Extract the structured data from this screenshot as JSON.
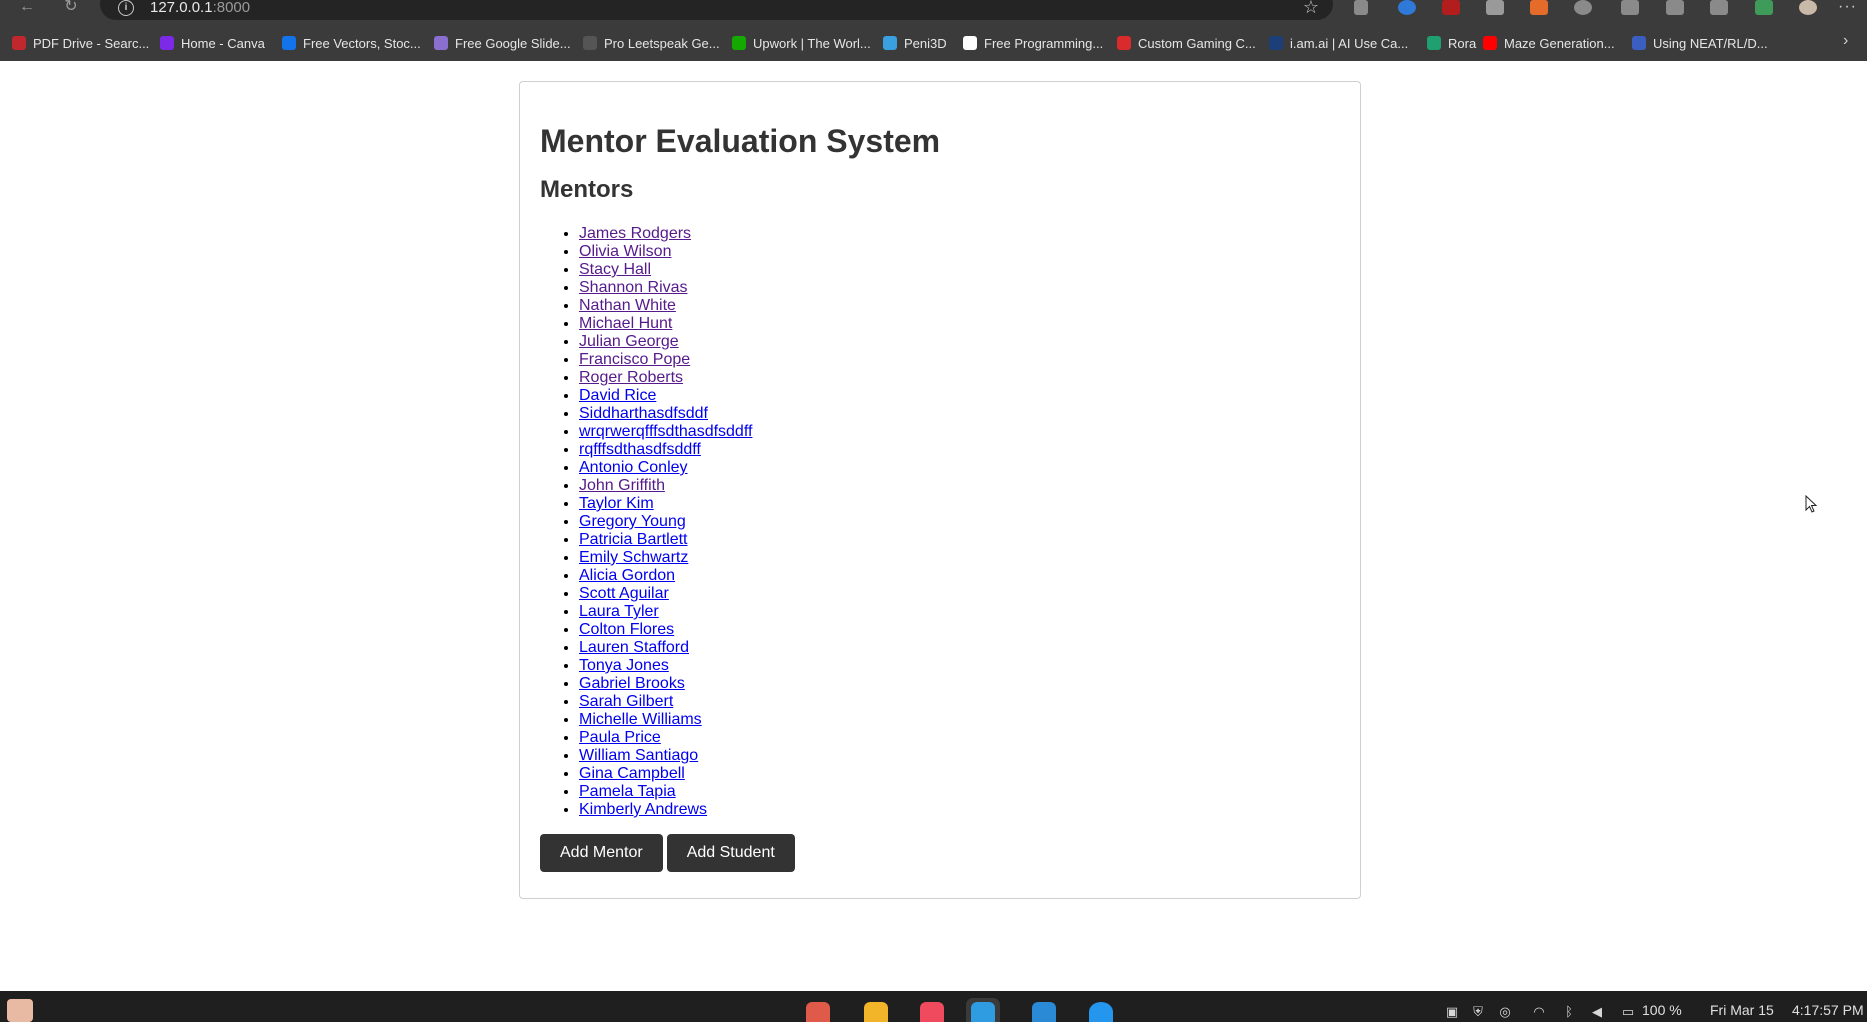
{
  "browser": {
    "url_host": "127.0.0.1",
    "url_port": ":8000",
    "bookmarks": [
      {
        "label": "PDF Drive - Searc...",
        "icon": "pdf-drive-icon",
        "color": "#c0282d"
      },
      {
        "label": "Home - Canva",
        "icon": "canva-icon",
        "color": "#7d2ae8"
      },
      {
        "label": "Free Vectors, Stoc...",
        "icon": "freepik-icon",
        "color": "#1273eb"
      },
      {
        "label": "Free Google Slide...",
        "icon": "slides-icon",
        "color": "#8a6fd1"
      },
      {
        "label": "Pro Leetspeak Ge...",
        "icon": "leetspeak-icon",
        "color": "#555555"
      },
      {
        "label": "Upwork | The Worl...",
        "icon": "upwork-icon",
        "color": "#14a800"
      },
      {
        "label": "Peni3D",
        "icon": "peni3d-icon",
        "color": "#3aa0e0"
      },
      {
        "label": "Free Programming...",
        "icon": "programming-icon",
        "color": "#ffffff"
      },
      {
        "label": "Custom Gaming C...",
        "icon": "gaming-icon",
        "color": "#d92b2b"
      },
      {
        "label": "i.am.ai | AI Use Ca...",
        "icon": "iamai-icon",
        "color": "#1c3f7a"
      },
      {
        "label": "Rora",
        "icon": "rora-icon",
        "color": "#20a070"
      },
      {
        "label": "Maze Generation...",
        "icon": "youtube-icon",
        "color": "#ff0000"
      },
      {
        "label": "Using NEAT/RL/D...",
        "icon": "neat-icon",
        "color": "#3b5fc0"
      }
    ]
  },
  "page": {
    "title": "Mentor Evaluation System",
    "section_heading": "Mentors",
    "mentors": [
      {
        "name": "James Rodgers",
        "visited": true
      },
      {
        "name": "Olivia Wilson",
        "visited": true
      },
      {
        "name": "Stacy Hall",
        "visited": true
      },
      {
        "name": "Shannon Rivas",
        "visited": true
      },
      {
        "name": "Nathan White",
        "visited": true
      },
      {
        "name": "Michael Hunt",
        "visited": true
      },
      {
        "name": "Julian George",
        "visited": true
      },
      {
        "name": "Francisco Pope",
        "visited": true
      },
      {
        "name": "Roger Roberts",
        "visited": true
      },
      {
        "name": "David Rice",
        "visited": false
      },
      {
        "name": "Siddharthasdfsddf",
        "visited": false
      },
      {
        "name": "wrqrwerqfffsdthasdfsddff",
        "visited": false
      },
      {
        "name": "rqfffsdthasdfsddff",
        "visited": false
      },
      {
        "name": "Antonio Conley",
        "visited": false
      },
      {
        "name": "John Griffith",
        "visited": true
      },
      {
        "name": "Taylor Kim",
        "visited": false
      },
      {
        "name": "Gregory Young",
        "visited": false
      },
      {
        "name": "Patricia Bartlett",
        "visited": false
      },
      {
        "name": "Emily Schwartz",
        "visited": false
      },
      {
        "name": "Alicia Gordon",
        "visited": false
      },
      {
        "name": "Scott Aguilar",
        "visited": false
      },
      {
        "name": "Laura Tyler",
        "visited": false
      },
      {
        "name": "Colton Flores",
        "visited": false
      },
      {
        "name": "Lauren Stafford",
        "visited": false
      },
      {
        "name": "Tonya Jones",
        "visited": false
      },
      {
        "name": "Gabriel Brooks",
        "visited": false
      },
      {
        "name": "Sarah Gilbert",
        "visited": false
      },
      {
        "name": "Michelle Williams",
        "visited": false
      },
      {
        "name": "Paula Price",
        "visited": false
      },
      {
        "name": "William Santiago",
        "visited": false
      },
      {
        "name": "Gina Campbell",
        "visited": false
      },
      {
        "name": "Pamela Tapia",
        "visited": false
      },
      {
        "name": "Kimberly Andrews",
        "visited": false
      }
    ],
    "add_mentor_label": "Add Mentor",
    "add_student_label": "Add Student"
  },
  "taskbar": {
    "battery": "100 %",
    "date": "Fri Mar 15",
    "time": "4:17:57 PM"
  },
  "colors": {
    "link": "#0000ee",
    "link_visited": "#551a8b",
    "button_bg": "#333333",
    "chrome_bg": "#3b3b3b"
  }
}
